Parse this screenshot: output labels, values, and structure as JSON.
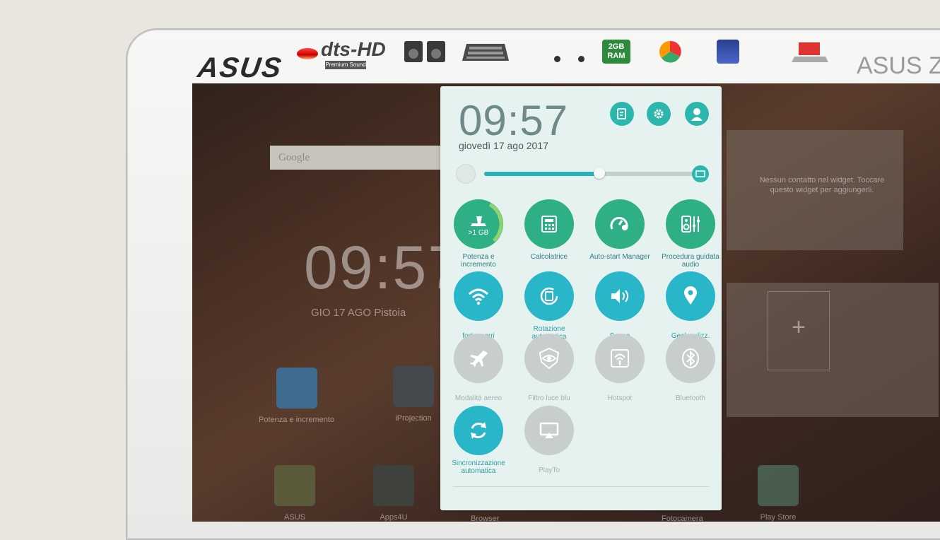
{
  "device": {
    "brand": "ASUS",
    "model_partial": "ASUS Ze",
    "stickers": [
      {
        "name": "dts-hd",
        "title": "dts-HD",
        "caption": "Premium Sound"
      },
      {
        "name": "speakers",
        "caption": ""
      },
      {
        "name": "keyboard",
        "caption": ""
      },
      {
        "name": "ram",
        "title": "2GB RAM",
        "caption": ""
      },
      {
        "name": "color",
        "caption": ""
      },
      {
        "name": "display",
        "caption": ""
      },
      {
        "name": "laptop",
        "caption": ""
      }
    ]
  },
  "home": {
    "search_label": "Google",
    "clock": "09:57",
    "date_line": "GIO 17 AGO  Pistoia",
    "apps": [
      {
        "label": "Potenza e incremento",
        "icon": "broom-icon"
      },
      {
        "label": "iProjection",
        "icon": "projector-icon"
      },
      {
        "label": "ASUS",
        "icon": "folder-icon"
      },
      {
        "label": "Apps4U",
        "icon": "folder-icon"
      },
      {
        "label": "Browser",
        "icon": "globe-icon"
      },
      {
        "label": "Fotocamera",
        "icon": "camera-icon"
      },
      {
        "label": "Play Store",
        "icon": "play-store-icon"
      }
    ],
    "widget_text": "Nessun contatto nel widget. Toccare questo widget per aggiungerli."
  },
  "panel": {
    "clock": "09:57",
    "date": "giovedì 17 ago 2017",
    "brightness_level": 0.55,
    "header_buttons": [
      "edit-icon",
      "settings-icon",
      "user-icon"
    ],
    "tiles": [
      {
        "label": "Potenza e incremento",
        "icon": "boost-icon",
        "state": "green",
        "badge": ">1 GB"
      },
      {
        "label": "Calcolatrice",
        "icon": "calculator-icon",
        "state": "green"
      },
      {
        "label": "Auto-start Manager",
        "icon": "auto-start-icon",
        "state": "green"
      },
      {
        "label": "Procedura guidata audio",
        "icon": "audio-wizard-icon",
        "state": "green"
      },
      {
        "label": "forteguerri",
        "icon": "wifi-icon",
        "state": "on"
      },
      {
        "label": "Rotazione automatica",
        "icon": "rotation-icon",
        "state": "on"
      },
      {
        "label": "Suono",
        "icon": "sound-icon",
        "state": "on"
      },
      {
        "label": "Geolocalizz.",
        "icon": "location-icon",
        "state": "on"
      },
      {
        "label": "Modalità aereo",
        "icon": "airplane-icon",
        "state": "off"
      },
      {
        "label": "Filtro luce blu",
        "icon": "eye-icon",
        "state": "off"
      },
      {
        "label": "Hotspot",
        "icon": "hotspot-icon",
        "state": "off"
      },
      {
        "label": "Bluetooth",
        "icon": "bluetooth-icon",
        "state": "off"
      },
      {
        "label": "Sincronizzazione automatica",
        "icon": "sync-icon",
        "state": "on"
      },
      {
        "label": "PlayTo",
        "icon": "playto-icon",
        "state": "off"
      }
    ]
  },
  "colors": {
    "accent_green": "#2eaf86",
    "accent_teal": "#29b6c9",
    "inactive_gray": "#c8cecd",
    "panel_bg": "#e6f2ef"
  }
}
